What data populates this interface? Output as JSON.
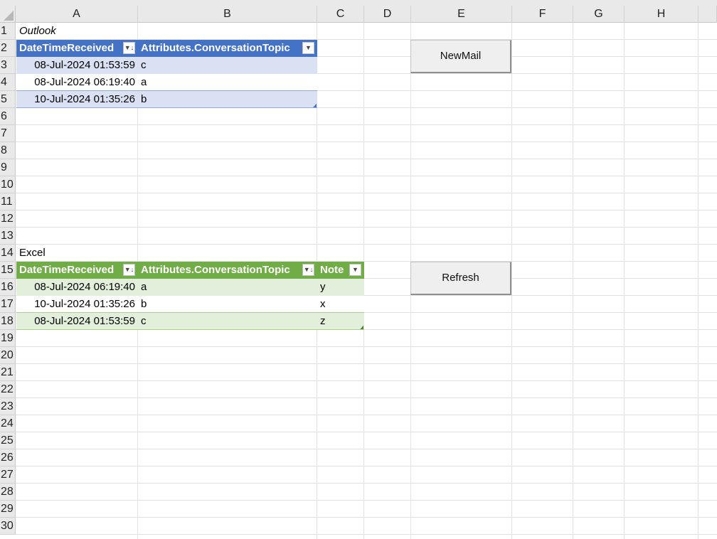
{
  "columns": [
    "A",
    "B",
    "C",
    "D",
    "E",
    "F",
    "G",
    "H"
  ],
  "rows": [
    "1",
    "2",
    "3",
    "4",
    "5",
    "6",
    "7",
    "8",
    "9",
    "10",
    "11",
    "12",
    "13",
    "14",
    "15",
    "16",
    "17",
    "18",
    "19",
    "20",
    "21",
    "22",
    "23",
    "24",
    "25",
    "26",
    "27",
    "28",
    "29",
    "30"
  ],
  "outlook": {
    "title": "Outlook",
    "headers": [
      "DateTimeReceived",
      "Attributes.ConversationTopic"
    ],
    "rows": [
      [
        "08-Jul-2024 01:53:59",
        "c"
      ],
      [
        "08-Jul-2024 06:19:40",
        "a"
      ],
      [
        "10-Jul-2024 01:35:26",
        "b"
      ]
    ],
    "colors": {
      "header": "#4472c4",
      "band": "#d9e1f2"
    }
  },
  "excel": {
    "title": "Excel",
    "headers": [
      "DateTimeReceived",
      "Attributes.ConversationTopic",
      "Note"
    ],
    "rows": [
      [
        "08-Jul-2024 06:19:40",
        "a",
        "y"
      ],
      [
        "10-Jul-2024 01:35:26",
        "b",
        "x"
      ],
      [
        "08-Jul-2024 01:53:59",
        "c",
        "z"
      ]
    ],
    "colors": {
      "header": "#70ad47",
      "band": "#e2efda"
    }
  },
  "buttons": {
    "newmail": "NewMail",
    "refresh": "Refresh"
  },
  "icons": {
    "sort_filter": "sort-filter-icon",
    "filter": "filter-dropdown-icon"
  }
}
